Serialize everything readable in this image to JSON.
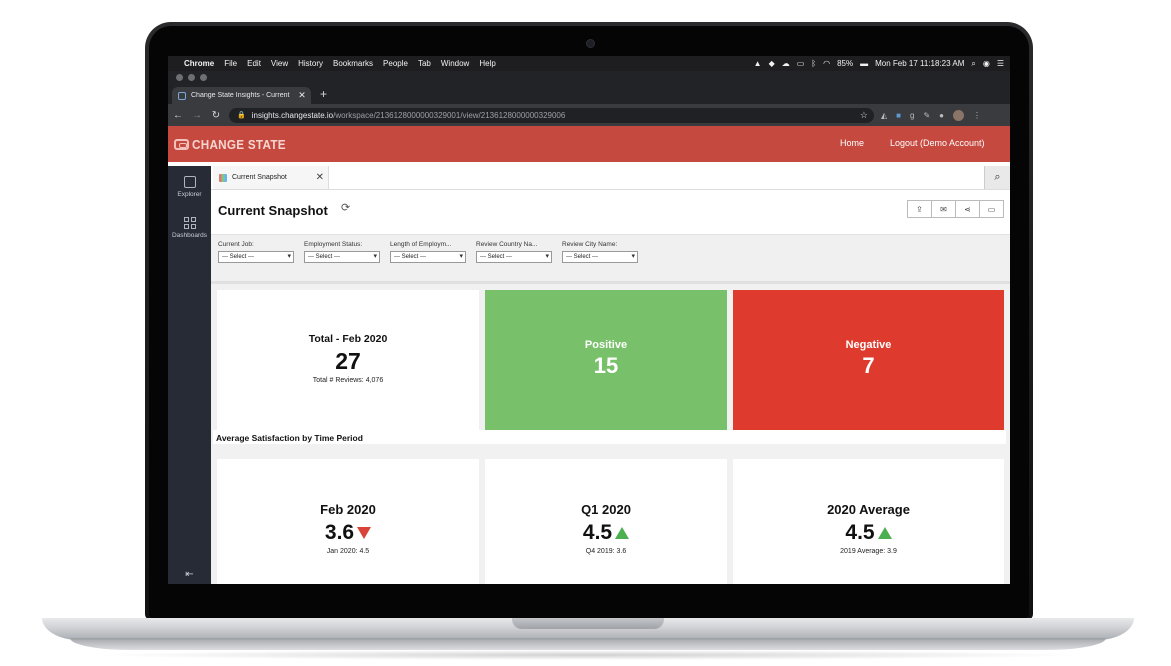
{
  "mac_menubar": {
    "app": "Chrome",
    "items": [
      "File",
      "Edit",
      "View",
      "History",
      "Bookmarks",
      "People",
      "Tab",
      "Window",
      "Help"
    ],
    "battery": "85%",
    "datetime": "Mon Feb 17  11:18:23 AM"
  },
  "browser": {
    "tab_title": "Change State Insights - Current",
    "new_tab": "+",
    "url_host": "insights.changestate.io",
    "url_path": "/workspace/2136128000000329001/view/2136128000000329006"
  },
  "app": {
    "logo_text": "CHANGE STATE",
    "nav": {
      "home": "Home",
      "logout": "Logout (Demo Account)"
    },
    "accent_color": "#c5493f"
  },
  "sidebar": {
    "items": [
      {
        "label": "Explorer",
        "icon": "explorer-icon"
      },
      {
        "label": "Dashboards",
        "icon": "dashboards-icon"
      }
    ],
    "collapse_icon": "collapse-icon"
  },
  "doc_tab": {
    "label": "Current Snapshot"
  },
  "page": {
    "title": "Current Snapshot",
    "actions": [
      "export-icon",
      "email-icon",
      "share-icon",
      "comment-icon"
    ]
  },
  "filters": [
    {
      "label": "Current Job:",
      "value": "--- Select ---"
    },
    {
      "label": "Employment Status:",
      "value": "--- Select ---"
    },
    {
      "label": "Length of Employm...",
      "value": "--- Select ---"
    },
    {
      "label": "Review Country Na...",
      "value": "--- Select ---"
    },
    {
      "label": "Review City Name:",
      "value": "--- Select ---"
    }
  ],
  "kpis": {
    "total": {
      "title": "Total - Feb 2020",
      "value": "27",
      "sub": "Total # Reviews: 4,076"
    },
    "positive": {
      "title": "Positive",
      "value": "15",
      "color": "#79c06a"
    },
    "negative": {
      "title": "Negative",
      "value": "7",
      "color": "#de3a2e"
    }
  },
  "section": {
    "title": "Average Satisfaction by Time Period"
  },
  "periods": [
    {
      "title": "Feb 2020",
      "value": "3.6",
      "trend": "down",
      "sub": "Jan 2020: 4.5"
    },
    {
      "title": "Q1 2020",
      "value": "4.5",
      "trend": "up",
      "sub": "Q4 2019: 3.6"
    },
    {
      "title": "2020 Average",
      "value": "4.5",
      "trend": "up",
      "sub": "2019 Average: 3.9"
    }
  ]
}
